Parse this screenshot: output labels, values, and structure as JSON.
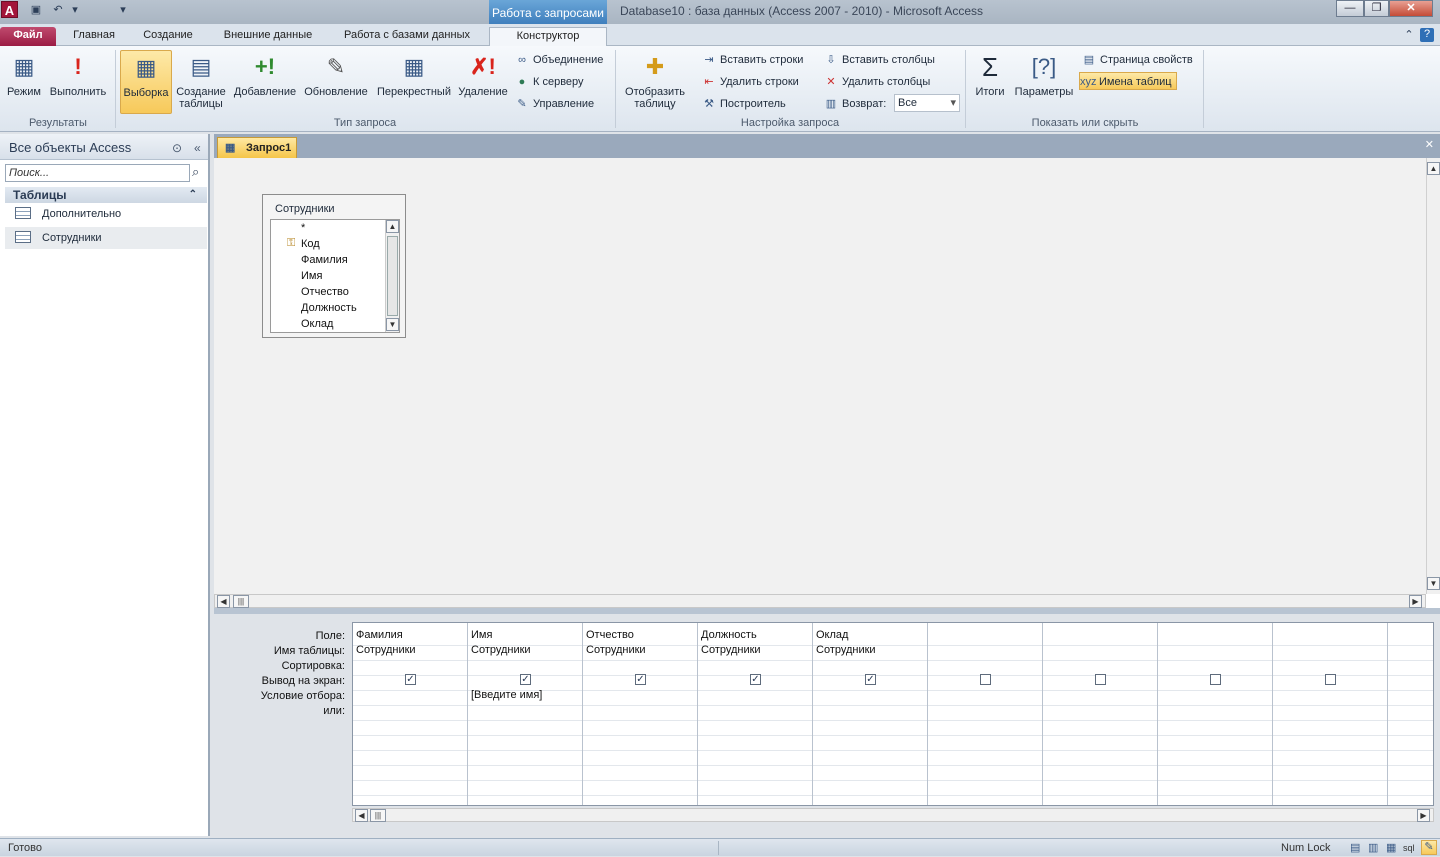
{
  "window": {
    "title": "Database10 : база данных (Access 2007 - 2010) - Microsoft Access",
    "context_tab_title": "Работа с запросами",
    "app_icon": "A",
    "controls": {
      "minimize": "—",
      "restore": "❐",
      "close": "✕"
    }
  },
  "tabs": {
    "file": "Файл",
    "home": "Главная",
    "create": "Создание",
    "external": "Внешние данные",
    "database": "Работа с базами данных",
    "design": "Конструктор"
  },
  "ribbon": {
    "results": {
      "label": "Результаты",
      "view": "Режим",
      "run": "Выполнить"
    },
    "query_type": {
      "label": "Тип запроса",
      "select": "Выборка",
      "make_table_1": "Создание",
      "make_table_2": "таблицы",
      "append": "Добавление",
      "update": "Обновление",
      "crosstab": "Перекрестный",
      "delete": "Удаление",
      "union": "Объединение",
      "passthrough": "К серверу",
      "ddl": "Управление"
    },
    "setup": {
      "label": "Настройка запроса",
      "show_table_1": "Отобразить",
      "show_table_2": "таблицу",
      "insert_rows": "Вставить строки",
      "delete_rows": "Удалить строки",
      "builder": "Построитель",
      "insert_cols": "Вставить столбцы",
      "delete_cols": "Удалить столбцы",
      "return_label": "Возврат:",
      "return_value": "Все"
    },
    "show_hide": {
      "label": "Показать или скрыть",
      "totals": "Итоги",
      "parameters": "Параметры",
      "property_sheet": "Страница свойств",
      "table_names": "Имена таблиц"
    }
  },
  "nav": {
    "header": "Все объекты Access",
    "search_placeholder": "Поиск...",
    "group": "Таблицы",
    "items": [
      "Дополнительно",
      "Сотрудники"
    ]
  },
  "document": {
    "tab": "Запрос1",
    "table_box": {
      "title": "Сотрудники",
      "fields": [
        "*",
        "Код",
        "Фамилия",
        "Имя",
        "Отчество",
        "Должность",
        "Оклад"
      ]
    },
    "grid": {
      "row_labels": [
        "Поле:",
        "Имя таблицы:",
        "Сортировка:",
        "Вывод на экран:",
        "Условие отбора:",
        "или:"
      ],
      "columns": [
        {
          "field": "Фамилия",
          "table": "Сотрудники",
          "show": true,
          "criteria": ""
        },
        {
          "field": "Имя",
          "table": "Сотрудники",
          "show": true,
          "criteria": "[Введите имя]"
        },
        {
          "field": "Отчество",
          "table": "Сотрудники",
          "show": true,
          "criteria": ""
        },
        {
          "field": "Должность",
          "table": "Сотрудники",
          "show": true,
          "criteria": ""
        },
        {
          "field": "Оклад",
          "table": "Сотрудники",
          "show": true,
          "criteria": ""
        },
        {
          "field": "",
          "table": "",
          "show": false,
          "criteria": ""
        },
        {
          "field": "",
          "table": "",
          "show": false,
          "criteria": ""
        },
        {
          "field": "",
          "table": "",
          "show": false,
          "criteria": ""
        },
        {
          "field": "",
          "table": "",
          "show": false,
          "criteria": ""
        }
      ]
    }
  },
  "status": {
    "left": "Готово",
    "numlock": "Num Lock",
    "sql": "sql"
  }
}
